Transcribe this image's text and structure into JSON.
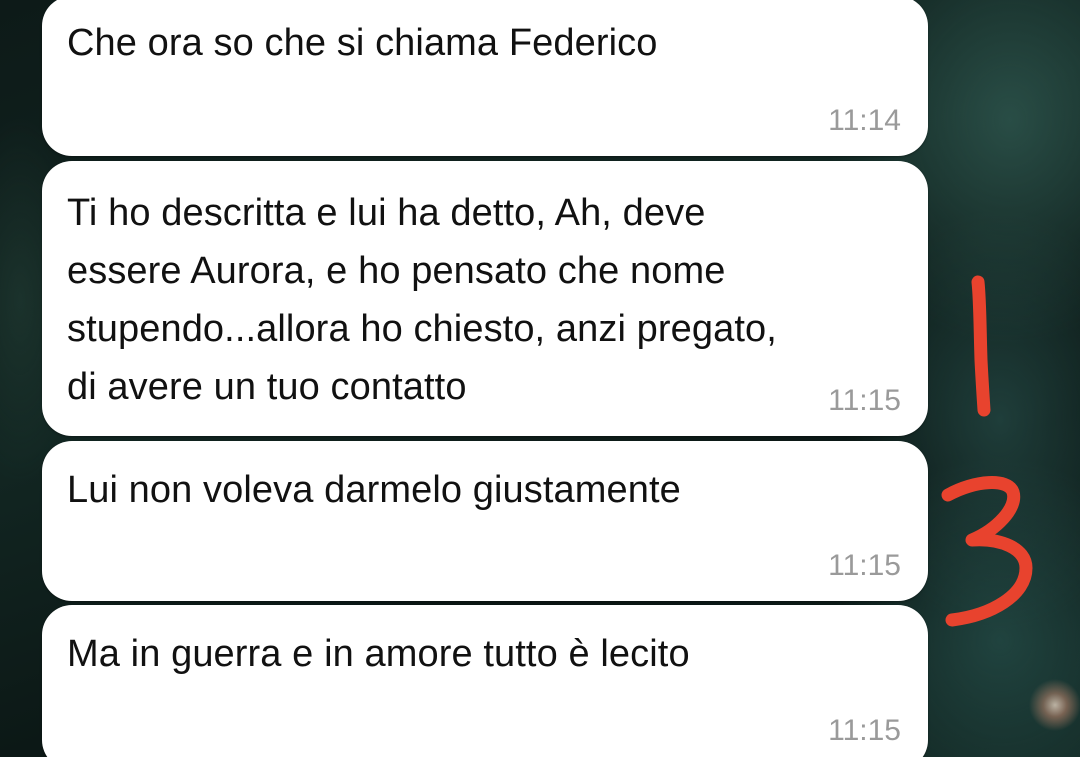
{
  "messages": [
    {
      "text": "Che ora so che si chiama Federico",
      "time": "11:14"
    },
    {
      "text": "Ti ho descritta e lui ha detto, Ah, deve essere Aurora, e ho pensato che nome stupendo...allora ho chiesto, anzi pregato, di avere un tuo contatto",
      "time": "11:15"
    },
    {
      "text": "Lui non voleva darmelo giustamente",
      "time": "11:15"
    },
    {
      "text": "Ma in guerra e in amore tutto è lecito",
      "time": "11:15"
    }
  ],
  "annotations": {
    "color": "#e8432e",
    "digits": [
      "1",
      "3"
    ]
  },
  "colors": {
    "bubble": "#ffffff",
    "text": "#111111",
    "timestamp": "#9a9a9a"
  }
}
